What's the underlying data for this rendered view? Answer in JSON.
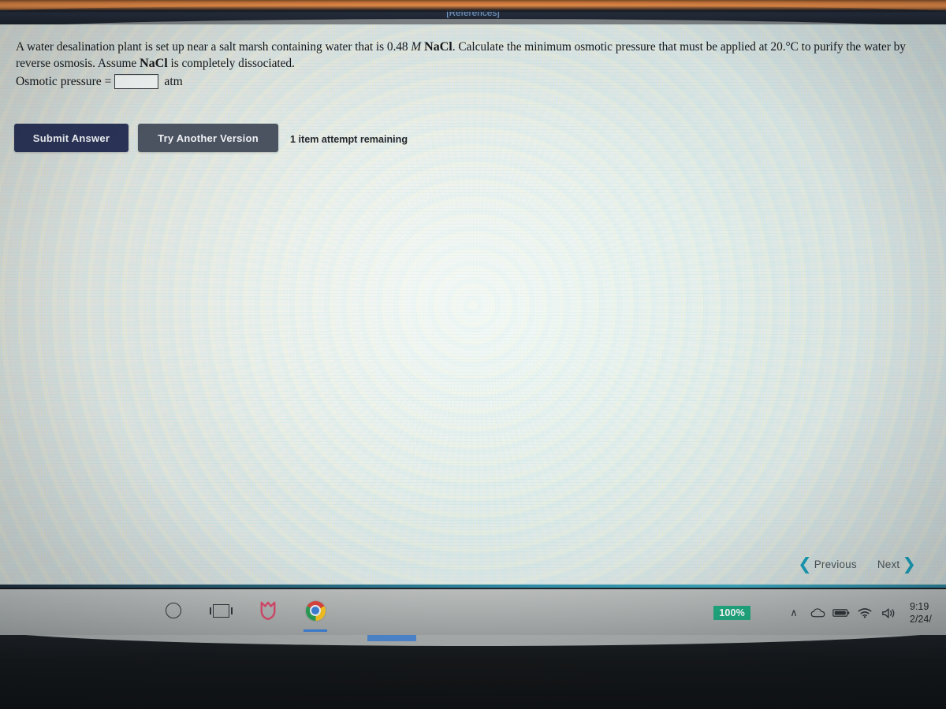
{
  "header": {
    "references_label": "[References]"
  },
  "question": {
    "part1": "A water desalination plant is set up near a salt marsh containing water that is ",
    "concentration": "0.48",
    "molarity_symbol": "M",
    "solute": "NaCl",
    "part2": ". Calculate the minimum osmotic pressure that must be applied at ",
    "temperature": "20.°C",
    "part3": " to purify the water by reverse osmosis. Assume ",
    "solute2": "NaCl",
    "part4": " is completely dissociated."
  },
  "answer": {
    "label": "Osmotic pressure =",
    "value": "",
    "placeholder": "",
    "unit": "atm"
  },
  "actions": {
    "submit_label": "Submit Answer",
    "try_another_label": "Try Another Version",
    "attempts_text": "1 item attempt remaining"
  },
  "pager": {
    "previous_label": "Previous",
    "next_label": "Next",
    "previous_chevron": "❮",
    "next_chevron": "❯"
  },
  "taskbar": {
    "icons": [
      {
        "name": "cortana-icon",
        "label": "Cortana"
      },
      {
        "name": "task-view-icon",
        "label": "Task View"
      },
      {
        "name": "security-shield-icon",
        "label": "360 Security"
      },
      {
        "name": "chrome-icon",
        "label": "Google Chrome"
      }
    ],
    "tray": {
      "zoom_badge": "100%",
      "show_hidden_icons": "∧",
      "onedrive_icon": "onedrive-cloud-icon",
      "battery_icon": "battery-icon",
      "network_icon": "wifi-icon",
      "volume_icon": "🔊",
      "clock_time": "9:19",
      "clock_date": "2/24/"
    }
  },
  "colors": {
    "submit_button": "#2a3356",
    "try_another_button": "#4b5260",
    "header_bar": "#232a38",
    "references_link": "#7fa3cc",
    "chevron_teal": "#1a9bb5",
    "zoom_badge": "#1fa97f",
    "teal_rule": "#2e8ba4"
  }
}
